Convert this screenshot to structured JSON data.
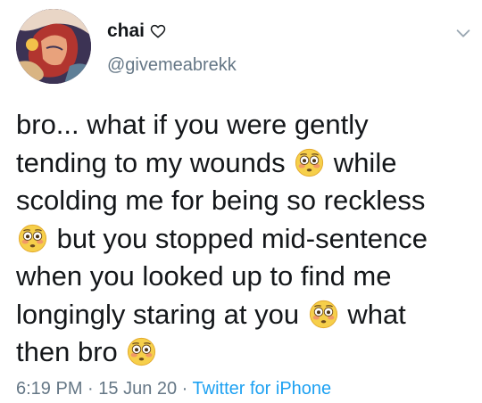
{
  "tweet": {
    "author": {
      "display_name": "chai",
      "handle": "@givemeabrekk",
      "name_icon": "heart-outline-icon"
    },
    "menu_icon": "chevron-down-icon",
    "text_lines": [
      [
        "bro... what if you were gently"
      ],
      [
        "tending to my wounds",
        "flushed-face-emoji",
        "while"
      ],
      [
        "scolding me for being so reckless"
      ],
      [
        "flushed-face-emoji",
        "but you stopped mid-sentence"
      ],
      [
        "when you looked up to find me"
      ],
      [
        "longingly staring at you",
        "flushed-face-emoji",
        "what"
      ],
      [
        "then bro",
        "flushed-face-emoji"
      ]
    ],
    "meta": {
      "time": "6:19 PM",
      "separator": " · ",
      "date": "15 Jun 20",
      "source": "Twitter for iPhone"
    },
    "colors": {
      "text": "#14171a",
      "secondary": "#657786",
      "link": "#1da1f2"
    }
  }
}
